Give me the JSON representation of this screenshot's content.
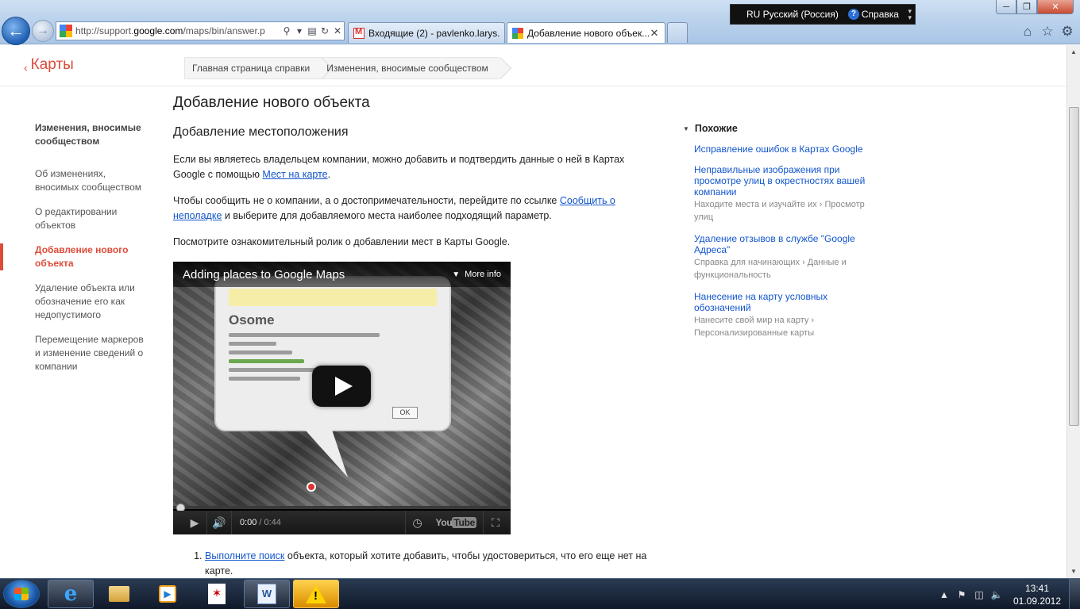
{
  "browser": {
    "url_prefix": "http://support.",
    "url_domain": "google.com",
    "url_suffix": "/maps/bin/answer.p",
    "tabs": [
      {
        "label": "Входящие (2) - pavlenko.larys..."
      },
      {
        "label": "Добавление нового объек..."
      }
    ],
    "language": "RU Русский (Россия)",
    "help_label": "Справка"
  },
  "header": {
    "product": "Карты",
    "breadcrumbs": [
      "Главная страница справки",
      "Изменения, вносимые сообществом"
    ]
  },
  "nav": {
    "heading": "Изменения, вносимые сообществом",
    "items": [
      "Об изменениях, вносимых сообществом",
      "О редактировании объектов",
      "Добавление нового объекта",
      "Удаление объекта или обозначение его как недопустимого",
      "Перемещение маркеров и изменение сведений о компании"
    ]
  },
  "article": {
    "title": "Добавление нового объекта",
    "section_title": "Добавление местоположения",
    "p1_text": "Если вы являетесь владельцем компании, можно добавить и подтвердить данные о ней в Картах Google с помощью ",
    "p1_link": "Мест на карте",
    "p1_end": ".",
    "p2_text": "Чтобы сообщить не о компании, а о достопримечательности, перейдите по ссылке ",
    "p2_link": "Сообщить о неполадке",
    "p2_end": " и выберите для добавляемого места наиболее подходящий параметр.",
    "p3_text": "Посмотрите ознакомительный ролик о добавлении мест в Карты Google.",
    "step1_link": "Выполните поиск",
    "step1_text": " объекта, который хотите добавить, чтобы удостовериться, что его еще нет на карте."
  },
  "video": {
    "title": "Adding places to Google Maps",
    "more_info": "More info",
    "place_name": "Osome",
    "ok_label": "OK",
    "time_current": "0:00",
    "time_sep": "/",
    "time_total": "0:44",
    "logo": "You",
    "logo_tube": "Tube",
    "progress": 0
  },
  "related": {
    "heading": "Похожие",
    "items": [
      {
        "title": "Исправление ошибок в Картах Google",
        "path": ""
      },
      {
        "title": "Неправильные изображения при просмотре улиц в окрестностях вашей компании",
        "path": "Находите места и изучайте их › Просмотр улиц"
      },
      {
        "title": "Удаление отзывов в службе \"Google Адреса\"",
        "path": "Справка для начинающих › Данные и функциональность"
      },
      {
        "title": "Нанесение на карту условных обозначений",
        "path": "Нанесите свой мир на карту › Персонализированные карты"
      }
    ]
  },
  "taskbar": {
    "time": "13:41",
    "date": "01.09.2012"
  },
  "colors": {
    "accent": "#dd4b39",
    "link": "#1155cc"
  }
}
